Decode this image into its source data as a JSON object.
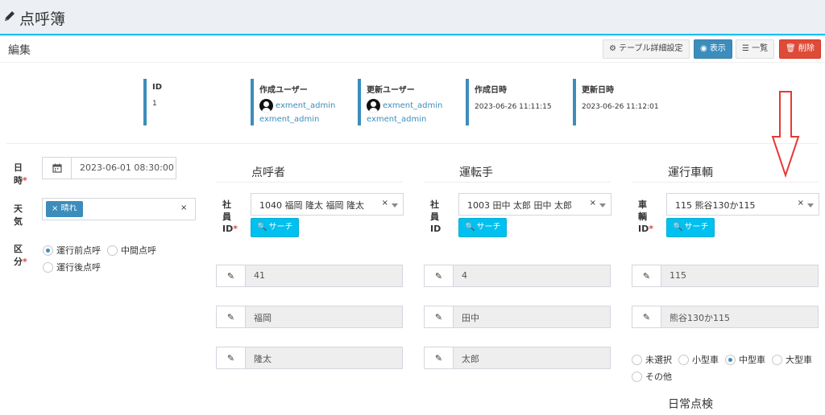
{
  "header": {
    "title": "点呼簿"
  },
  "box": {
    "title": "編集",
    "buttons": {
      "table_settings": "テーブル詳細設定",
      "view": "表示",
      "list": "一覧",
      "delete": "削除"
    }
  },
  "meta": {
    "id_label": "ID",
    "id_value": "1",
    "created_user_label": "作成ユーザー",
    "created_user_name": "exment_admin",
    "created_user_name2": "exment_admin",
    "updated_user_label": "更新ユーザー",
    "updated_user_name": "exment_admin",
    "updated_user_name2": "exment_admin",
    "created_at_label": "作成日時",
    "created_at_value": "2023-06-26 11:11:15",
    "updated_at_label": "更新日時",
    "updated_at_value": "2023-06-26 11:12:01"
  },
  "form": {
    "datetime_label_1": "日",
    "datetime_label_2": "時",
    "datetime_value": "2023-06-01 08:30:00",
    "weather_label_1": "天",
    "weather_label_2": "気",
    "weather_tag": "晴れ",
    "category_label_1": "区",
    "category_label_2": "分",
    "category_options": [
      "運行前点呼",
      "中間点呼",
      "運行後点呼"
    ],
    "category_selected": 0,
    "required_mark": "*"
  },
  "sections": {
    "caller": {
      "title": "点呼者",
      "label": [
        "社",
        "員",
        "ID"
      ],
      "required": true,
      "select_value": "1040 福岡 隆太 福岡 隆太",
      "search_label": "サーチ",
      "fields": [
        "41",
        "福岡",
        "隆太"
      ]
    },
    "driver": {
      "title": "運転手",
      "label": [
        "社",
        "員",
        "ID"
      ],
      "required": false,
      "select_value": "1003 田中 太郎 田中 太郎",
      "search_label": "サーチ",
      "fields": [
        "4",
        "田中",
        "太郎"
      ]
    },
    "vehicle": {
      "title": "運行車輌",
      "label": [
        "車",
        "輌",
        "ID"
      ],
      "required": true,
      "select_value": "115 熊谷130か115",
      "search_label": "サーチ",
      "fields": [
        "115",
        "熊谷130か115"
      ],
      "size_options": [
        "未選択",
        "小型車",
        "中型車",
        "大型車",
        "その他"
      ],
      "size_selected": 2,
      "daily_check_title": "日常点検"
    }
  },
  "colors": {
    "accent": "#3c8dbc",
    "search": "#00c0ef",
    "danger": "#dd4b39",
    "annotation": "#e53935"
  }
}
